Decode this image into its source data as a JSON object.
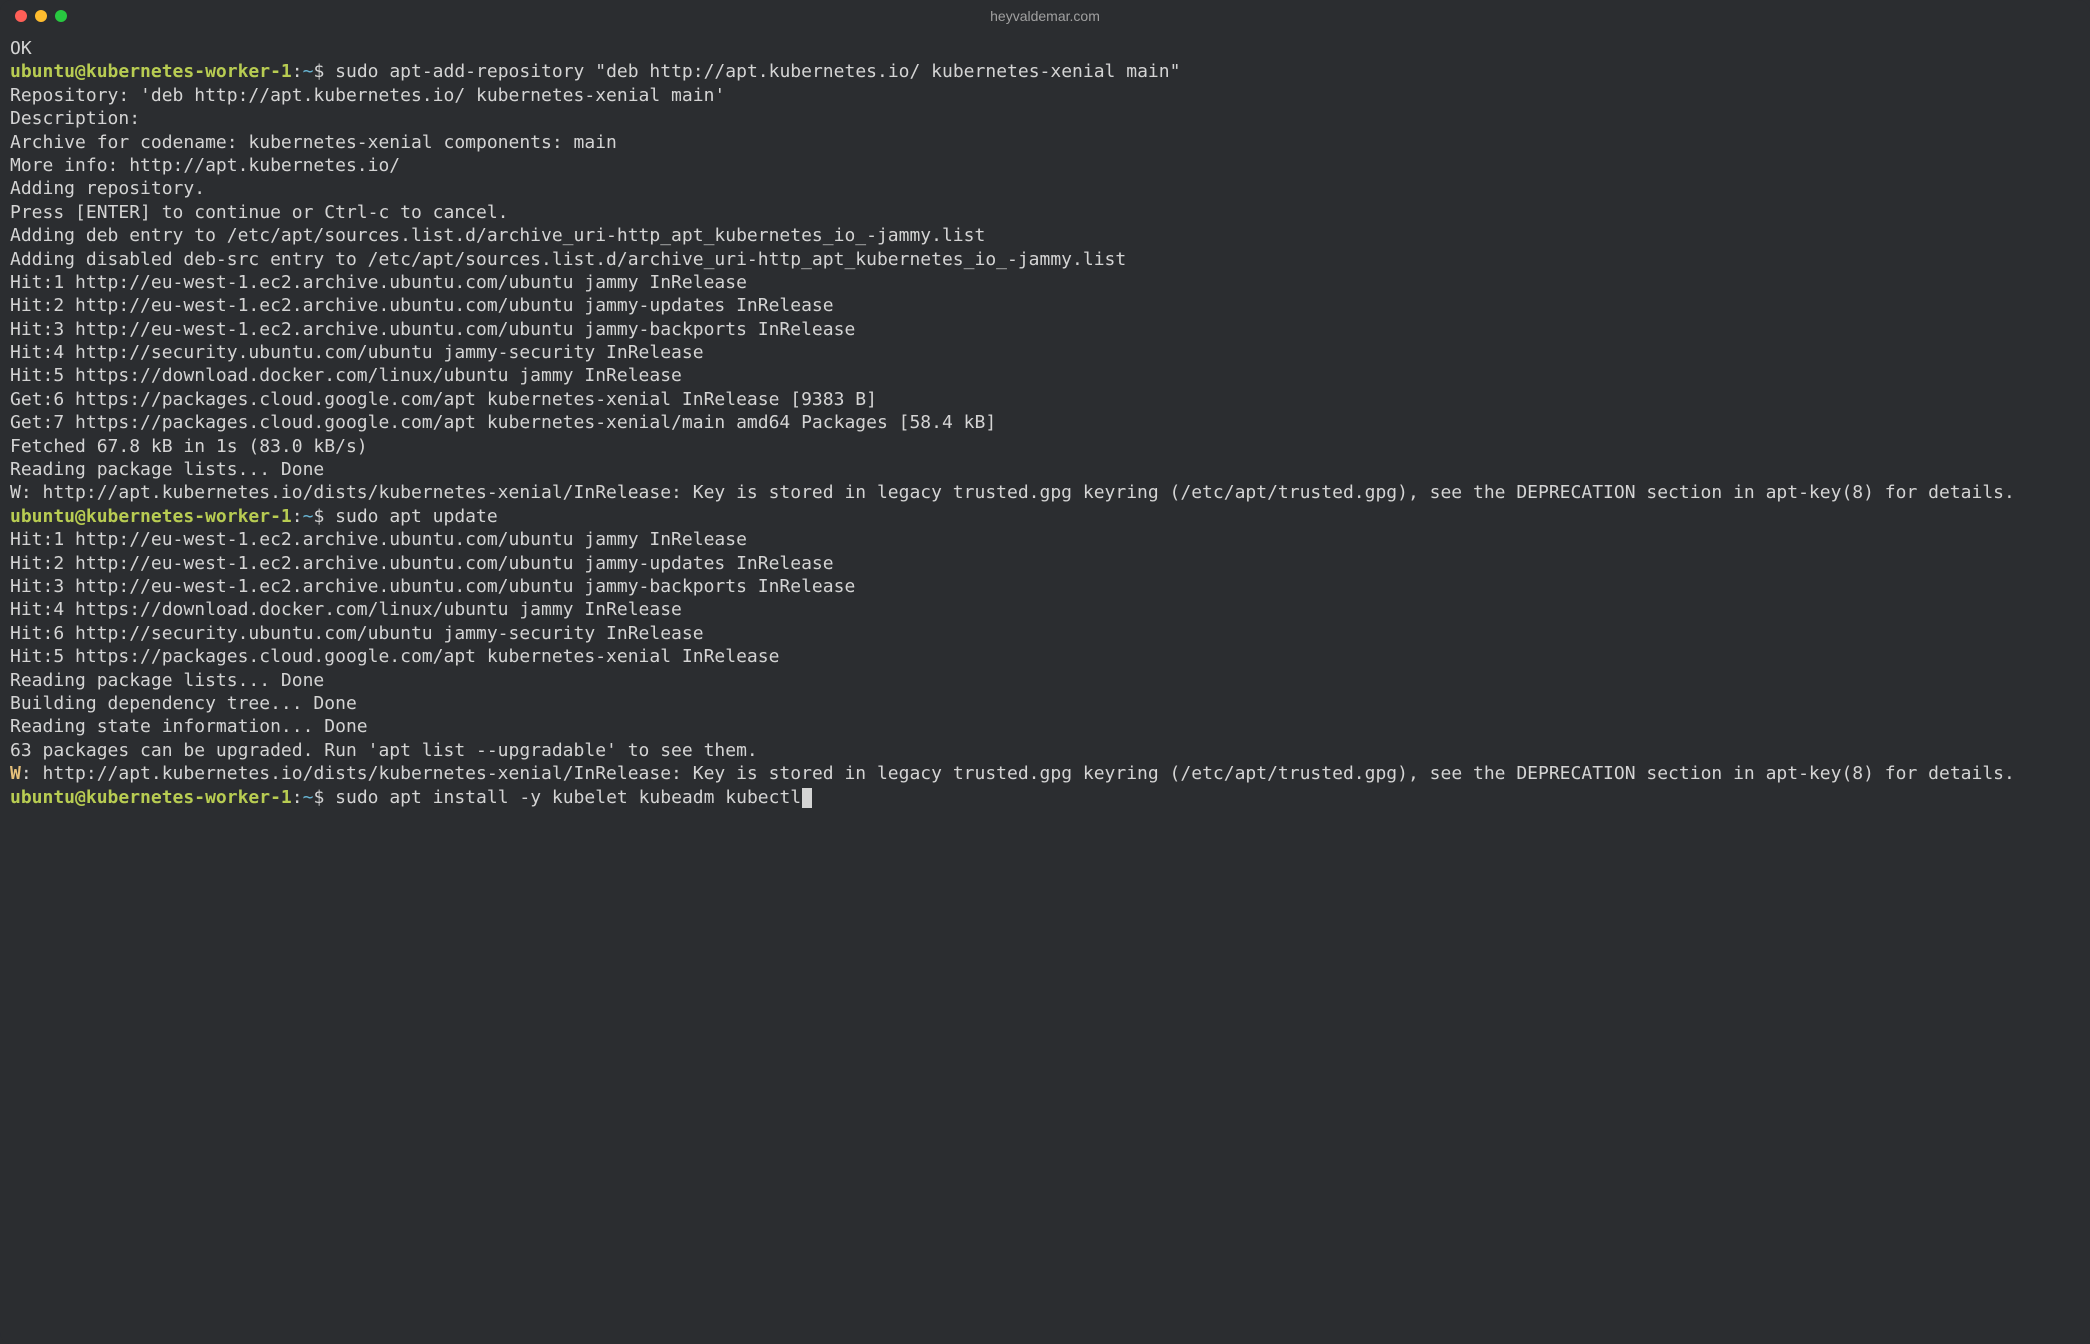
{
  "window": {
    "title": "heyvaldemar.com"
  },
  "prompt": {
    "user_host": "ubuntu@kubernetes-worker-1",
    "sep": ":",
    "path": "~",
    "dollar": "$"
  },
  "lines": [
    {
      "type": "output",
      "text": "OK"
    },
    {
      "type": "prompt",
      "command": "sudo apt-add-repository \"deb http://apt.kubernetes.io/ kubernetes-xenial main\""
    },
    {
      "type": "output",
      "text": "Repository: 'deb http://apt.kubernetes.io/ kubernetes-xenial main'"
    },
    {
      "type": "output",
      "text": "Description:"
    },
    {
      "type": "output",
      "text": "Archive for codename: kubernetes-xenial components: main"
    },
    {
      "type": "output",
      "text": "More info: http://apt.kubernetes.io/"
    },
    {
      "type": "output",
      "text": "Adding repository."
    },
    {
      "type": "output",
      "text": "Press [ENTER] to continue or Ctrl-c to cancel."
    },
    {
      "type": "output",
      "text": "Adding deb entry to /etc/apt/sources.list.d/archive_uri-http_apt_kubernetes_io_-jammy.list"
    },
    {
      "type": "output",
      "text": "Adding disabled deb-src entry to /etc/apt/sources.list.d/archive_uri-http_apt_kubernetes_io_-jammy.list"
    },
    {
      "type": "output",
      "text": "Hit:1 http://eu-west-1.ec2.archive.ubuntu.com/ubuntu jammy InRelease"
    },
    {
      "type": "output",
      "text": "Hit:2 http://eu-west-1.ec2.archive.ubuntu.com/ubuntu jammy-updates InRelease"
    },
    {
      "type": "output",
      "text": "Hit:3 http://eu-west-1.ec2.archive.ubuntu.com/ubuntu jammy-backports InRelease"
    },
    {
      "type": "output",
      "text": "Hit:4 http://security.ubuntu.com/ubuntu jammy-security InRelease"
    },
    {
      "type": "output",
      "text": "Hit:5 https://download.docker.com/linux/ubuntu jammy InRelease"
    },
    {
      "type": "output",
      "text": "Get:6 https://packages.cloud.google.com/apt kubernetes-xenial InRelease [9383 B]"
    },
    {
      "type": "output",
      "text": "Get:7 https://packages.cloud.google.com/apt kubernetes-xenial/main amd64 Packages [58.4 kB]"
    },
    {
      "type": "output",
      "text": "Fetched 67.8 kB in 1s (83.0 kB/s)"
    },
    {
      "type": "output",
      "text": "Reading package lists... Done"
    },
    {
      "type": "output",
      "text": "W: http://apt.kubernetes.io/dists/kubernetes-xenial/InRelease: Key is stored in legacy trusted.gpg keyring (/etc/apt/trusted.gpg), see the DEPRECATION section in apt-key(8) for details."
    },
    {
      "type": "prompt",
      "command": "sudo apt update"
    },
    {
      "type": "output",
      "text": "Hit:1 http://eu-west-1.ec2.archive.ubuntu.com/ubuntu jammy InRelease"
    },
    {
      "type": "output",
      "text": "Hit:2 http://eu-west-1.ec2.archive.ubuntu.com/ubuntu jammy-updates InRelease"
    },
    {
      "type": "output",
      "text": "Hit:3 http://eu-west-1.ec2.archive.ubuntu.com/ubuntu jammy-backports InRelease"
    },
    {
      "type": "output",
      "text": "Hit:4 https://download.docker.com/linux/ubuntu jammy InRelease"
    },
    {
      "type": "output",
      "text": "Hit:6 http://security.ubuntu.com/ubuntu jammy-security InRelease"
    },
    {
      "type": "output",
      "text": "Hit:5 https://packages.cloud.google.com/apt kubernetes-xenial InRelease"
    },
    {
      "type": "output",
      "text": "Reading package lists... Done"
    },
    {
      "type": "output",
      "text": "Building dependency tree... Done"
    },
    {
      "type": "output",
      "text": "Reading state information... Done"
    },
    {
      "type": "output",
      "text": "63 packages can be upgraded. Run 'apt list --upgradable' to see them."
    },
    {
      "type": "warn",
      "prefix": "W",
      "text": ": http://apt.kubernetes.io/dists/kubernetes-xenial/InRelease: Key is stored in legacy trusted.gpg keyring (/etc/apt/trusted.gpg), see the DEPRECATION section in apt-key(8) for details."
    },
    {
      "type": "prompt",
      "command": "sudo apt install -y kubelet kubeadm kubectl",
      "cursor": true
    }
  ]
}
